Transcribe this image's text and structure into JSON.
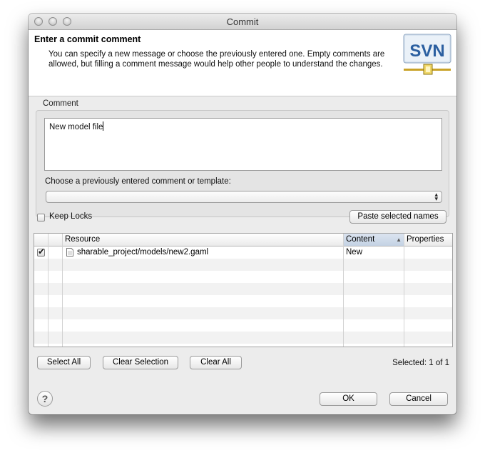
{
  "window": {
    "title": "Commit"
  },
  "header": {
    "title": "Enter a commit comment",
    "description": "You can specify a new message or choose the previously entered one. Empty comments are allowed, but filling a comment message would help other people to understand the changes.",
    "logo_text": "SVN",
    "logo_icon": "svn-logo-icon"
  },
  "comment_group": {
    "label": "Comment",
    "value": "New model file",
    "choose_label": "Choose a previously entered comment or template:",
    "combo_value": ""
  },
  "options": {
    "keep_locks_label": "Keep Locks",
    "keep_locks_checked": false,
    "paste_button": "Paste selected names"
  },
  "table": {
    "columns": [
      "Resource",
      "Content",
      "Properties"
    ],
    "sorted_column": "Content",
    "rows": [
      {
        "checked": true,
        "resource": "sharable_project/models/new2.gaml",
        "content": "New",
        "properties": ""
      }
    ]
  },
  "selection_buttons": {
    "select_all": "Select All",
    "clear_selection": "Clear Selection",
    "clear_all": "Clear All"
  },
  "status": {
    "selected_text": "Selected: 1 of 1"
  },
  "footer": {
    "ok": "OK",
    "cancel": "Cancel",
    "help_icon": "help-icon"
  },
  "colors": {
    "accent": "#3a6fb0",
    "svn_bg": "#d8e3ef",
    "svn_text": "#2b5fa0",
    "svn_rail": "#c9a227"
  }
}
